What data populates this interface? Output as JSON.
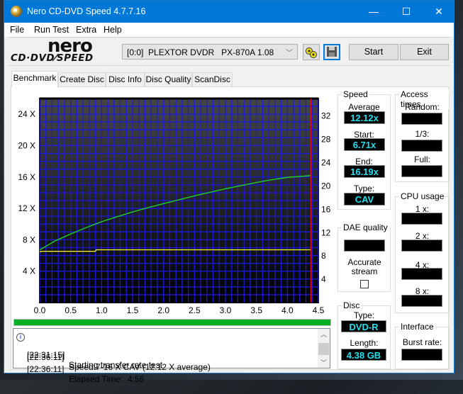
{
  "window": {
    "title": "Nero CD-DVD Speed 4.7.7.16",
    "controls": {
      "minimize": "—",
      "maximize": "☐",
      "close": "✕"
    }
  },
  "menu": [
    "File",
    "Run Test",
    "Extra",
    "Help"
  ],
  "logo": {
    "brand": "nero",
    "product": "CD·DVD⁄SPEED"
  },
  "toolbar": {
    "drive": "[0:0]  PLEXTOR DVDR   PX-870A 1.08",
    "drive_icon": "chevron-down-icon",
    "config_icon": "drive-settings-icon",
    "save_icon": "floppy-save-icon",
    "start_label": "Start",
    "exit_label": "Exit"
  },
  "tabs": [
    "Benchmark",
    "Create Disc",
    "Disc Info",
    "Disc Quality",
    "ScanDisc"
  ],
  "active_tab": "Benchmark",
  "chart_data": {
    "type": "line",
    "title": "",
    "xlabel": "",
    "ylabel": "",
    "xlim": [
      0,
      4.5
    ],
    "ylim": [
      0,
      26
    ],
    "y2lim": [
      0,
      35
    ],
    "x_ticks": [
      "0.0",
      "0.5",
      "1.0",
      "1.5",
      "2.0",
      "2.5",
      "3.0",
      "3.5",
      "4.0",
      "4.5"
    ],
    "y_ticks": [
      "4 X",
      "8 X",
      "12 X",
      "16 X",
      "20 X",
      "24 X"
    ],
    "y2_ticks": [
      "4",
      "8",
      "12",
      "16",
      "20",
      "24",
      "28",
      "32"
    ],
    "grid": true,
    "end_marker_x": 4.38,
    "series": [
      {
        "name": "Transfer speed",
        "axis": "left",
        "color": "#22dd22",
        "x": [
          0.0,
          0.25,
          0.5,
          0.75,
          1.0,
          1.25,
          1.5,
          1.75,
          2.0,
          2.25,
          2.5,
          2.75,
          3.0,
          3.25,
          3.5,
          3.75,
          4.0,
          4.25,
          4.38
        ],
        "y": [
          6.71,
          7.85,
          8.75,
          9.55,
          10.3,
          10.95,
          11.55,
          12.1,
          12.6,
          13.1,
          13.6,
          14.05,
          14.5,
          14.9,
          15.3,
          15.65,
          15.95,
          16.1,
          16.19
        ]
      },
      {
        "name": "Rotation speed",
        "axis": "right",
        "color": "#ffff33",
        "x": [
          0.0,
          0.03,
          0.9,
          0.91,
          4.38
        ],
        "y": [
          8.7,
          8.8,
          8.8,
          9.05,
          9.05
        ]
      }
    ]
  },
  "progress": {
    "value_percent": 100,
    "color": "#06b025"
  },
  "log": [
    {
      "time": "[22:31:15]",
      "message": "Starting transfer rate test",
      "icon": "info-icon"
    },
    {
      "time": "[22:36:11]",
      "message": "Speed:7-16 X CAV (12.12 X average)"
    },
    {
      "time": "[22:36:11]",
      "message": "Elapsed Time:  4:56"
    }
  ],
  "speed": {
    "title": "Speed",
    "average_label": "Average",
    "average": "12.12x",
    "start_label": "Start:",
    "start": "6.71x",
    "end_label": "End:",
    "end": "16.19x",
    "type_label": "Type:",
    "type": "CAV"
  },
  "access_times": {
    "title": "Access times",
    "random_label": "Random:",
    "random": "",
    "third_label": "1/3:",
    "third": "",
    "full_label": "Full:",
    "full": ""
  },
  "cpu_usage": {
    "title": "CPU usage",
    "x1_label": "1 x:",
    "x2_label": "2 x:",
    "x4_label": "4 x:",
    "x8_label": "8 x:"
  },
  "dae": {
    "title": "DAE quality",
    "value": "",
    "accurate_label": "Accurate stream",
    "accurate_checked": false
  },
  "disc": {
    "title": "Disc",
    "type_label": "Type:",
    "type": "DVD-R",
    "length_label": "Length:",
    "length": "4.38 GB"
  },
  "interface": {
    "title": "Interface",
    "burst_label": "Burst rate:",
    "burst": ""
  }
}
